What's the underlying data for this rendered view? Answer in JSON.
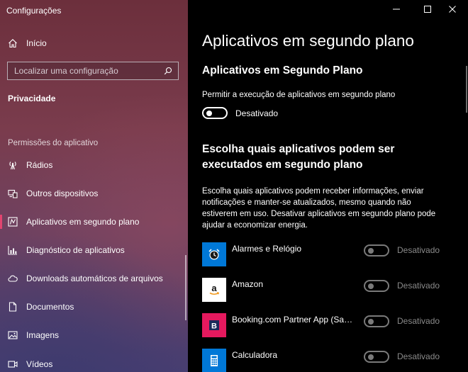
{
  "window": {
    "title": "Configurações",
    "controls": {
      "minimize": "minimize-icon",
      "maximize": "maximize-icon",
      "close": "close-icon"
    }
  },
  "sidebar": {
    "home": {
      "label": "Início",
      "icon": "home-icon"
    },
    "search": {
      "placeholder": "Localizar uma configuração",
      "icon": "search-icon"
    },
    "section": "Privacidade",
    "group_header": "Permissões do aplicativo",
    "items": [
      {
        "label": "Rádios",
        "icon": "radio-tower-icon"
      },
      {
        "label": "Outros dispositivos",
        "icon": "devices-icon"
      },
      {
        "label": "Aplicativos em segundo plano",
        "icon": "background-apps-icon",
        "selected": true
      },
      {
        "label": "Diagnóstico de aplicativos",
        "icon": "diagnostics-chart-icon"
      },
      {
        "label": "Downloads automáticos de arquivos",
        "icon": "cloud-icon"
      },
      {
        "label": "Documentos",
        "icon": "document-icon"
      },
      {
        "label": "Imagens",
        "icon": "image-icon"
      },
      {
        "label": "Vídeos",
        "icon": "video-icon"
      }
    ],
    "accent_color": "#e14570"
  },
  "main": {
    "page_title": "Aplicativos em segundo plano",
    "section1_title": "Aplicativos em Segundo Plano",
    "allow_label": "Permitir a execução de aplicativos em segundo plano",
    "master_toggle": {
      "on": false,
      "state_label": "Desativado"
    },
    "section2_title": "Escolha quais aplicativos podem ser executados em segundo plano",
    "description": "Escolha quais aplicativos podem receber informações, enviar notificações e manter-se atualizados, mesmo quando não estiverem em uso. Desativar aplicativos em segundo plano pode ajudar a economizar energia.",
    "apps": [
      {
        "name": "Alarmes e Relógio",
        "state_label": "Desativado",
        "on": false,
        "tile_color": "#0078d7",
        "icon": "alarm-clock-icon"
      },
      {
        "name": "Amazon",
        "state_label": "Desativado",
        "on": false,
        "tile_color": "#ffffff",
        "icon": "amazon-logo-icon"
      },
      {
        "name": "Booking.com Partner App (Samsung)",
        "state_label": "Desativado",
        "on": false,
        "tile_color": "#e5195e",
        "icon": "booking-b-icon"
      },
      {
        "name": "Calculadora",
        "state_label": "Desativado",
        "on": false,
        "tile_color": "#0078d7",
        "icon": "calculator-icon"
      }
    ]
  }
}
